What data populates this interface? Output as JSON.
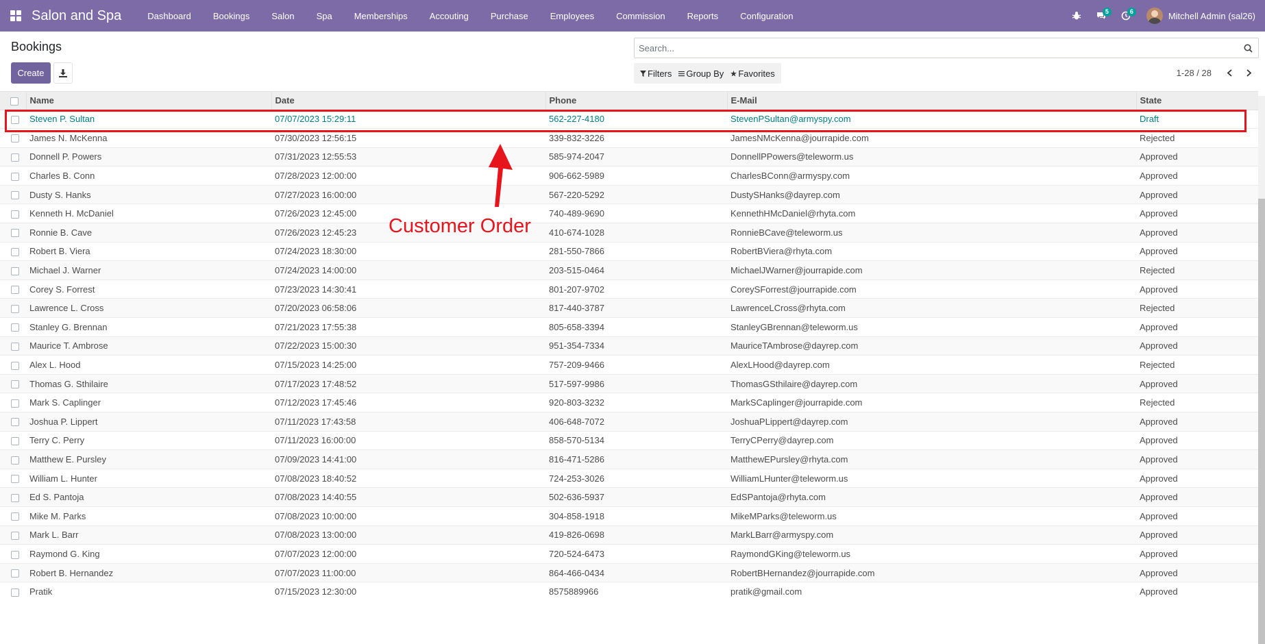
{
  "navbar": {
    "brand": "Salon and Spa",
    "menu": [
      "Dashboard",
      "Bookings",
      "Salon",
      "Spa",
      "Memberships",
      "Accouting",
      "Purchase",
      "Employees",
      "Commission",
      "Reports",
      "Configuration"
    ],
    "messages_count": "5",
    "activities_count": "6",
    "user_name": "Mitchell Admin (sal26)"
  },
  "control_panel": {
    "title": "Bookings",
    "create_label": "Create",
    "search_placeholder": "Search...",
    "filters_label": "Filters",
    "group_by_label": "Group By",
    "favorites_label": "Favorites",
    "pager_value": "1-28 / 28"
  },
  "table": {
    "columns": [
      "Name",
      "Date",
      "Phone",
      "E-Mail",
      "State"
    ],
    "rows": [
      [
        "Steven P. Sultan",
        "07/07/2023 15:29:11",
        "562-227-4180",
        "StevenPSultan@armyspy.com",
        "Draft"
      ],
      [
        "James N. McKenna",
        "07/30/2023 12:56:15",
        "339-832-3226",
        "JamesNMcKenna@jourrapide.com",
        "Rejected"
      ],
      [
        "Donnell P. Powers",
        "07/31/2023 12:55:53",
        "585-974-2047",
        "DonnellPPowers@teleworm.us",
        "Approved"
      ],
      [
        "Charles B. Conn",
        "07/28/2023 12:00:00",
        "906-662-5989",
        "CharlesBConn@armyspy.com",
        "Approved"
      ],
      [
        "Dusty S. Hanks",
        "07/27/2023 16:00:00",
        "567-220-5292",
        "DustySHanks@dayrep.com",
        "Approved"
      ],
      [
        "Kenneth H. McDaniel",
        "07/26/2023 12:45:00",
        "740-489-9690",
        "KennethHMcDaniel@rhyta.com",
        "Approved"
      ],
      [
        "Ronnie B. Cave",
        "07/26/2023 12:45:23",
        "410-674-1028",
        "RonnieBCave@teleworm.us",
        "Approved"
      ],
      [
        "Robert B. Viera",
        "07/24/2023 18:30:00",
        "281-550-7866",
        "RobertBViera@rhyta.com",
        "Approved"
      ],
      [
        "Michael J. Warner",
        "07/24/2023 14:00:00",
        "203-515-0464",
        "MichaelJWarner@jourrapide.com",
        "Rejected"
      ],
      [
        "Corey S. Forrest",
        "07/23/2023 14:30:41",
        "801-207-9702",
        "CoreySForrest@jourrapide.com",
        "Approved"
      ],
      [
        "Lawrence L. Cross",
        "07/20/2023 06:58:06",
        "817-440-3787",
        "LawrenceLCross@rhyta.com",
        "Rejected"
      ],
      [
        "Stanley G. Brennan",
        "07/21/2023 17:55:38",
        "805-658-3394",
        "StanleyGBrennan@teleworm.us",
        "Approved"
      ],
      [
        "Maurice T. Ambrose",
        "07/22/2023 15:00:30",
        "951-354-7334",
        "MauriceTAmbrose@dayrep.com",
        "Approved"
      ],
      [
        "Alex L. Hood",
        "07/15/2023 14:25:00",
        "757-209-9466",
        "AlexLHood@dayrep.com",
        "Rejected"
      ],
      [
        "Thomas G. Sthilaire",
        "07/17/2023 17:48:52",
        "517-597-9986",
        "ThomasGSthilaire@dayrep.com",
        "Approved"
      ],
      [
        "Mark S. Caplinger",
        "07/12/2023 17:45:46",
        "920-803-3232",
        "MarkSCaplinger@jourrapide.com",
        "Rejected"
      ],
      [
        "Joshua P. Lippert",
        "07/11/2023 17:43:58",
        "406-648-7072",
        "JoshuaPLippert@dayrep.com",
        "Approved"
      ],
      [
        "Terry C. Perry",
        "07/11/2023 16:00:00",
        "858-570-5134",
        "TerryCPerry@dayrep.com",
        "Approved"
      ],
      [
        "Matthew E. Pursley",
        "07/09/2023 14:41:00",
        "816-471-5286",
        "MatthewEPursley@rhyta.com",
        "Approved"
      ],
      [
        "William L. Hunter",
        "07/08/2023 18:40:52",
        "724-253-3026",
        "WilliamLHunter@teleworm.us",
        "Approved"
      ],
      [
        "Ed S. Pantoja",
        "07/08/2023 14:40:55",
        "502-636-5937",
        "EdSPantoja@rhyta.com",
        "Approved"
      ],
      [
        "Mike M. Parks",
        "07/08/2023 10:00:00",
        "304-858-1918",
        "MikeMParks@teleworm.us",
        "Approved"
      ],
      [
        "Mark L. Barr",
        "07/08/2023 13:00:00",
        "419-826-0698",
        "MarkLBarr@armyspy.com",
        "Approved"
      ],
      [
        "Raymond G. King",
        "07/07/2023 12:00:00",
        "720-524-6473",
        "RaymondGKing@teleworm.us",
        "Approved"
      ],
      [
        "Robert B. Hernandez",
        "07/07/2023 11:00:00",
        "864-466-0434",
        "RobertBHernandez@jourrapide.com",
        "Approved"
      ],
      [
        "Pratik",
        "07/15/2023 12:30:00",
        "8575889966",
        "pratik@gmail.com",
        "Approved"
      ]
    ]
  },
  "annotation": {
    "label": "Customer Order",
    "color": "#e8141c"
  },
  "colors": {
    "navbar": "#7c6ba6",
    "primary_button": "#71639e",
    "link": "#017e84",
    "badge": "#00a09d"
  }
}
